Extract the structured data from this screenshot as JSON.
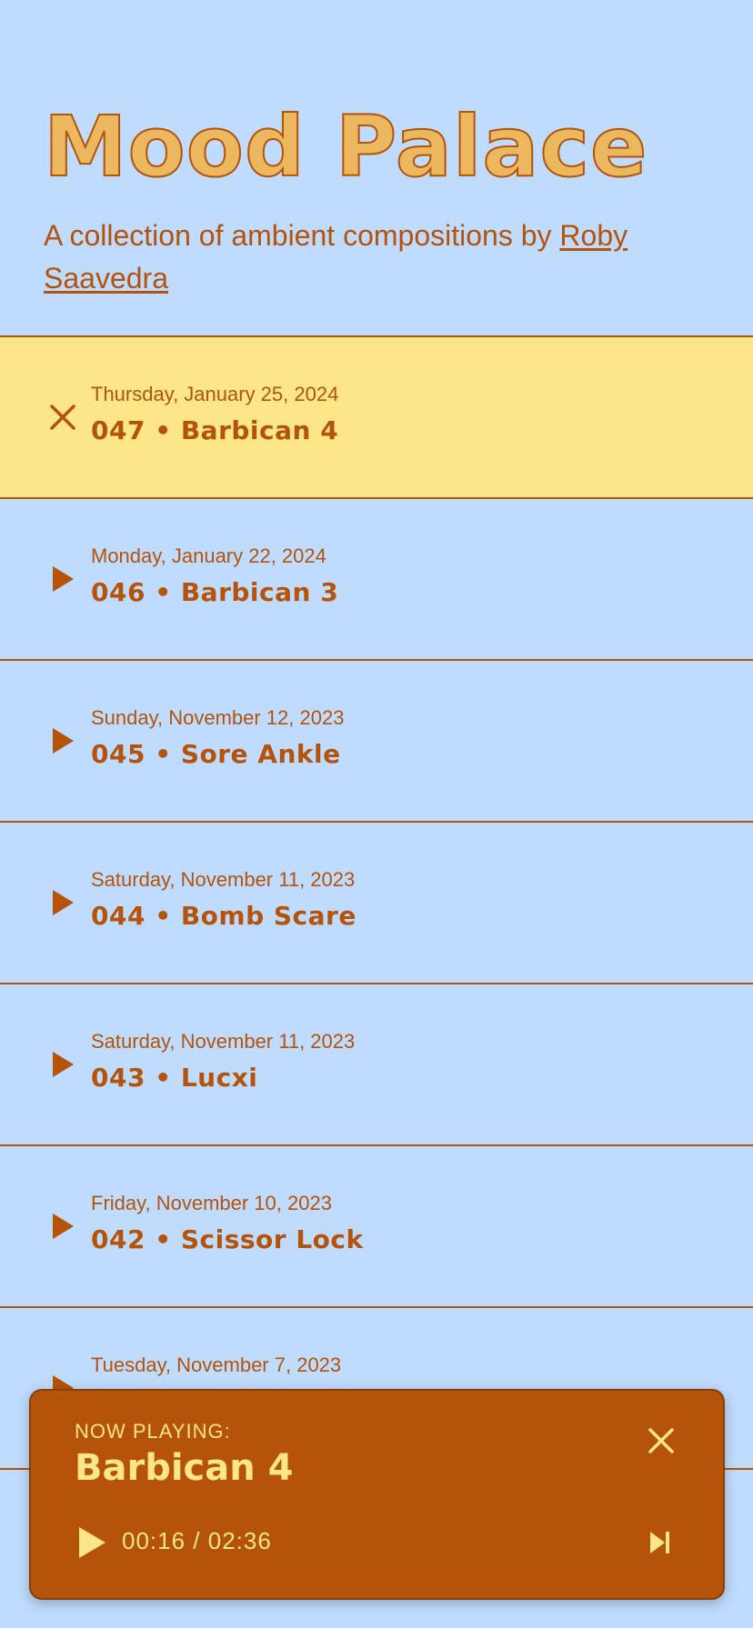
{
  "header": {
    "title": "Mood Palace",
    "subtitle_prefix": "A collection of ambient compositions by ",
    "author_link": "Roby Saavedra"
  },
  "tracks": [
    {
      "date": "Thursday, January 25, 2024",
      "title": "047 • Barbican 4",
      "icon": "close-icon",
      "active": true
    },
    {
      "date": "Monday, January 22, 2024",
      "title": "046 • Barbican 3",
      "icon": "play-icon",
      "active": false
    },
    {
      "date": "Sunday, November 12, 2023",
      "title": "045 • Sore Ankle",
      "icon": "play-icon",
      "active": false
    },
    {
      "date": "Saturday, November 11, 2023",
      "title": "044 • Bomb Scare",
      "icon": "play-icon",
      "active": false
    },
    {
      "date": "Saturday, November 11, 2023",
      "title": "043 • Lucxi",
      "icon": "play-icon",
      "active": false
    },
    {
      "date": "Friday, November 10, 2023",
      "title": "042 • Scissor Lock",
      "icon": "play-icon",
      "active": false
    },
    {
      "date": "Tuesday, November 7, 2023",
      "title": "",
      "icon": "play-icon",
      "active": false
    }
  ],
  "player": {
    "label": "NOW PLAYING:",
    "title": "Barbican 4",
    "time": "00:16 / 02:36"
  },
  "colors": {
    "background": "#bfdbfe",
    "accent": "#b45309",
    "active_row": "#fde68a",
    "title_fill": "#ebb85f"
  }
}
